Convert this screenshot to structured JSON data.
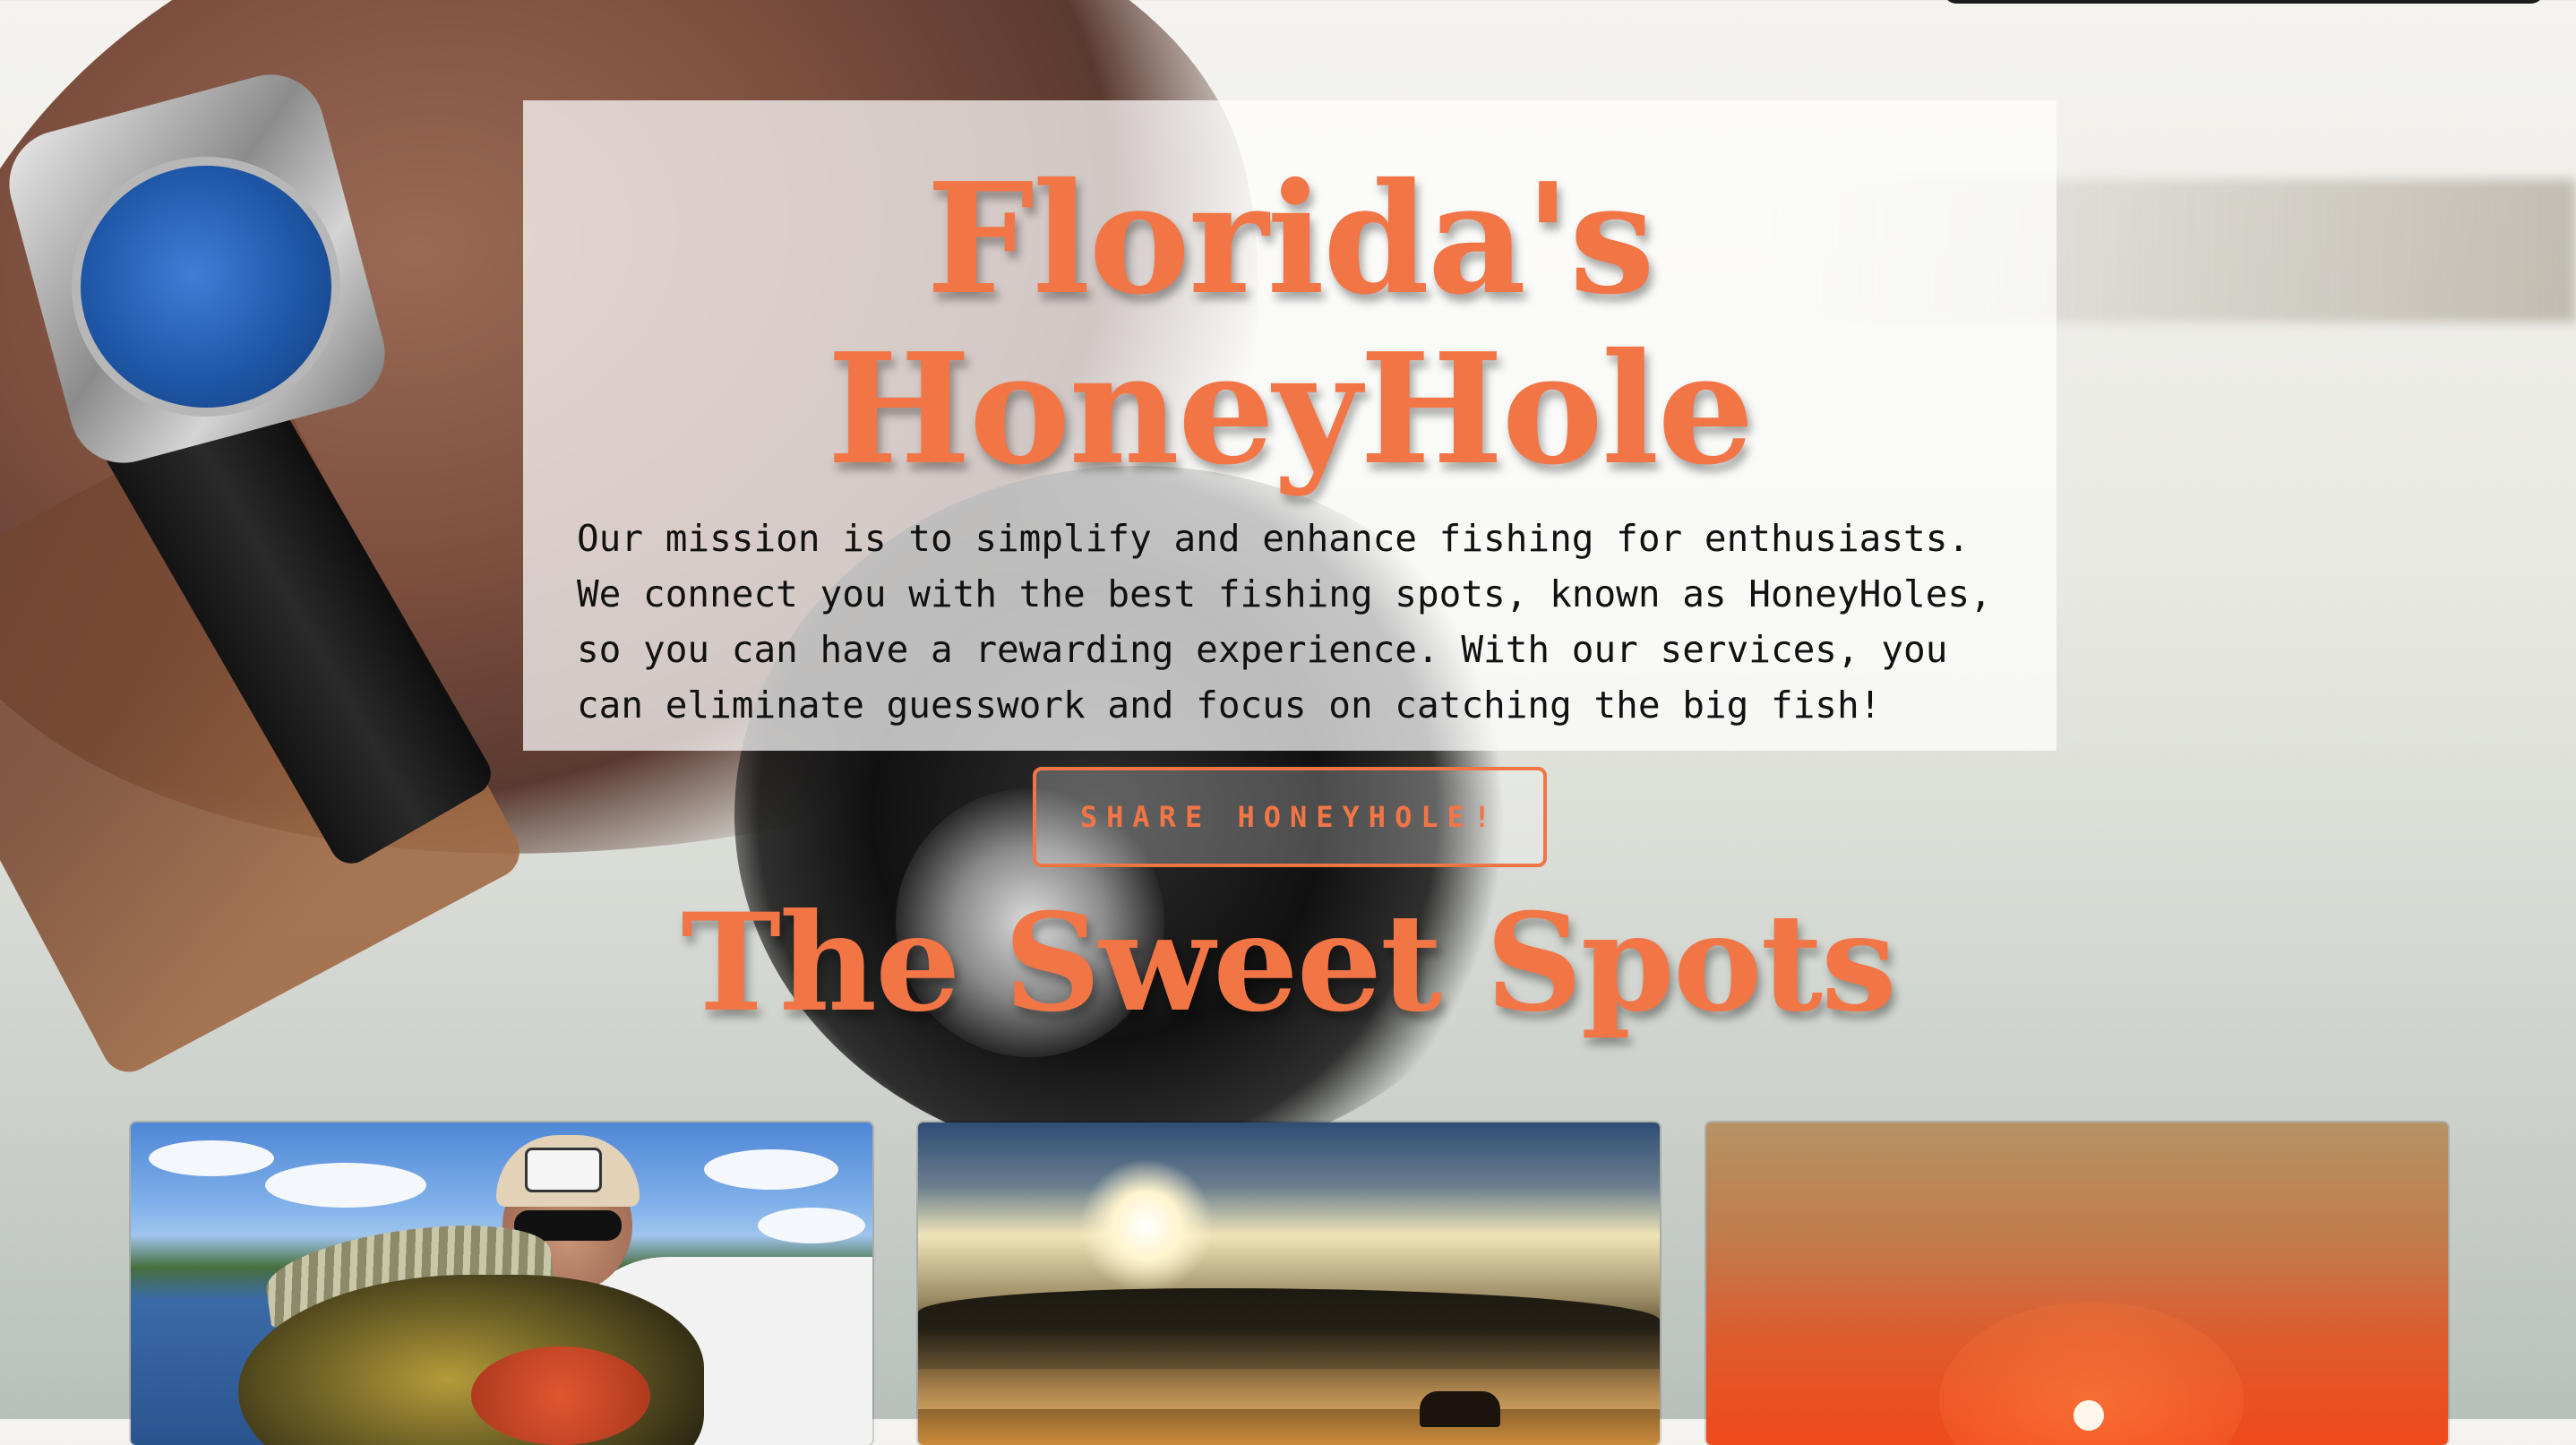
{
  "hero": {
    "title": "Florida's HoneyHole",
    "mission": "Our mission is to simplify and enhance fishing for enthusiasts. We connect you with the best fishing spots, known as HoneyHoles, so you can have a rewarding experience. With our services, you can eliminate guesswork and focus on catching the big fish!",
    "button_label": "SHARE HONEYHOLE!"
  },
  "section": {
    "title": "The Sweet Spots"
  },
  "colors": {
    "accent": "#f27546",
    "panel": "rgba(255,255,255,0.72)",
    "body_text": "#111111"
  },
  "cards": [
    {
      "icon": "photo-fisherman-with-fish"
    },
    {
      "icon": "photo-misty-lake-sunrise"
    },
    {
      "icon": "photo-orange-sunset"
    }
  ]
}
